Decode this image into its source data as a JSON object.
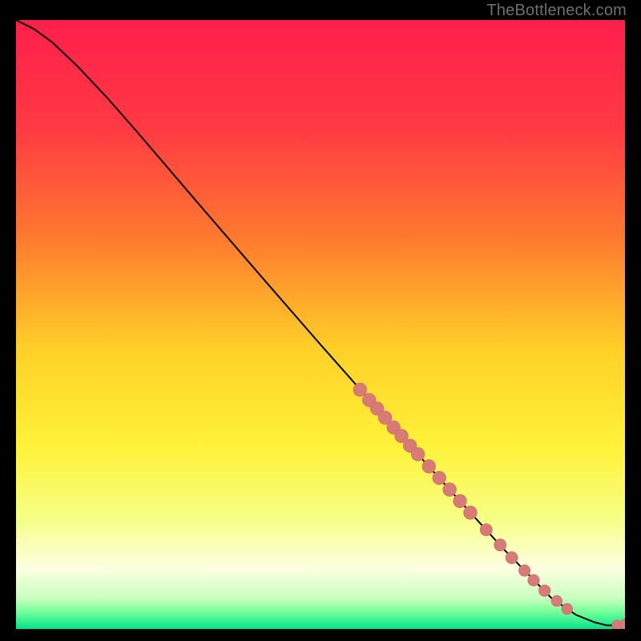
{
  "watermark": "TheBottleneck.com",
  "colors": {
    "gradient_stops": [
      {
        "offset": 0.0,
        "color": "#ff1f4b"
      },
      {
        "offset": 0.18,
        "color": "#ff3a43"
      },
      {
        "offset": 0.36,
        "color": "#ff7a2f"
      },
      {
        "offset": 0.54,
        "color": "#ffd028"
      },
      {
        "offset": 0.7,
        "color": "#fff238"
      },
      {
        "offset": 0.82,
        "color": "#f6ff86"
      },
      {
        "offset": 0.9,
        "color": "#fdffe0"
      },
      {
        "offset": 0.95,
        "color": "#c8ffbf"
      },
      {
        "offset": 0.97,
        "color": "#7dff9c"
      },
      {
        "offset": 1.0,
        "color": "#00e48a"
      }
    ],
    "curve": "#000000",
    "marker_fill": "#d87a78",
    "marker_stroke": "#c96864"
  },
  "chart_data": {
    "type": "line",
    "title": "",
    "xlabel": "",
    "ylabel": "",
    "xlim": [
      0,
      100
    ],
    "ylim": [
      0,
      100
    ],
    "grid": false,
    "legend": false,
    "curve": [
      {
        "x": 0,
        "y": 100
      },
      {
        "x": 3,
        "y": 98.5
      },
      {
        "x": 6,
        "y": 96.3
      },
      {
        "x": 10,
        "y": 92.5
      },
      {
        "x": 15,
        "y": 87.2
      },
      {
        "x": 20,
        "y": 81.5
      },
      {
        "x": 30,
        "y": 69.8
      },
      {
        "x": 40,
        "y": 58.2
      },
      {
        "x": 50,
        "y": 46.7
      },
      {
        "x": 60,
        "y": 35.4
      },
      {
        "x": 70,
        "y": 24.2
      },
      {
        "x": 80,
        "y": 13.2
      },
      {
        "x": 88,
        "y": 5.0
      },
      {
        "x": 92,
        "y": 2.3
      },
      {
        "x": 95,
        "y": 1.1
      },
      {
        "x": 97,
        "y": 0.6
      },
      {
        "x": 99,
        "y": 0.6
      },
      {
        "x": 100,
        "y": 0.8
      }
    ],
    "markers": [
      {
        "x": 56.5,
        "y": 39.3,
        "r": 1.1
      },
      {
        "x": 58.0,
        "y": 37.6,
        "r": 1.1
      },
      {
        "x": 59.3,
        "y": 36.2,
        "r": 1.1
      },
      {
        "x": 60.6,
        "y": 34.7,
        "r": 1.1
      },
      {
        "x": 62.0,
        "y": 33.1,
        "r": 1.1
      },
      {
        "x": 63.3,
        "y": 31.7,
        "r": 1.1
      },
      {
        "x": 64.7,
        "y": 30.1,
        "r": 1.1
      },
      {
        "x": 66.0,
        "y": 28.7,
        "r": 1.1
      },
      {
        "x": 67.8,
        "y": 26.7,
        "r": 1.1
      },
      {
        "x": 69.5,
        "y": 24.8,
        "r": 1.1
      },
      {
        "x": 71.2,
        "y": 22.9,
        "r": 1.1
      },
      {
        "x": 72.9,
        "y": 21.0,
        "r": 1.1
      },
      {
        "x": 74.6,
        "y": 19.1,
        "r": 1.1
      },
      {
        "x": 77.2,
        "y": 16.3,
        "r": 1.0
      },
      {
        "x": 79.5,
        "y": 13.8,
        "r": 1.0
      },
      {
        "x": 81.4,
        "y": 11.7,
        "r": 1.0
      },
      {
        "x": 83.5,
        "y": 9.6,
        "r": 0.95
      },
      {
        "x": 85.0,
        "y": 8.0,
        "r": 0.95
      },
      {
        "x": 86.8,
        "y": 6.3,
        "r": 0.95
      },
      {
        "x": 88.8,
        "y": 4.6,
        "r": 0.9
      },
      {
        "x": 90.5,
        "y": 3.3,
        "r": 0.9
      },
      {
        "x": 98.7,
        "y": 0.6,
        "r": 0.85
      },
      {
        "x": 100.0,
        "y": 0.8,
        "r": 0.85
      }
    ]
  }
}
